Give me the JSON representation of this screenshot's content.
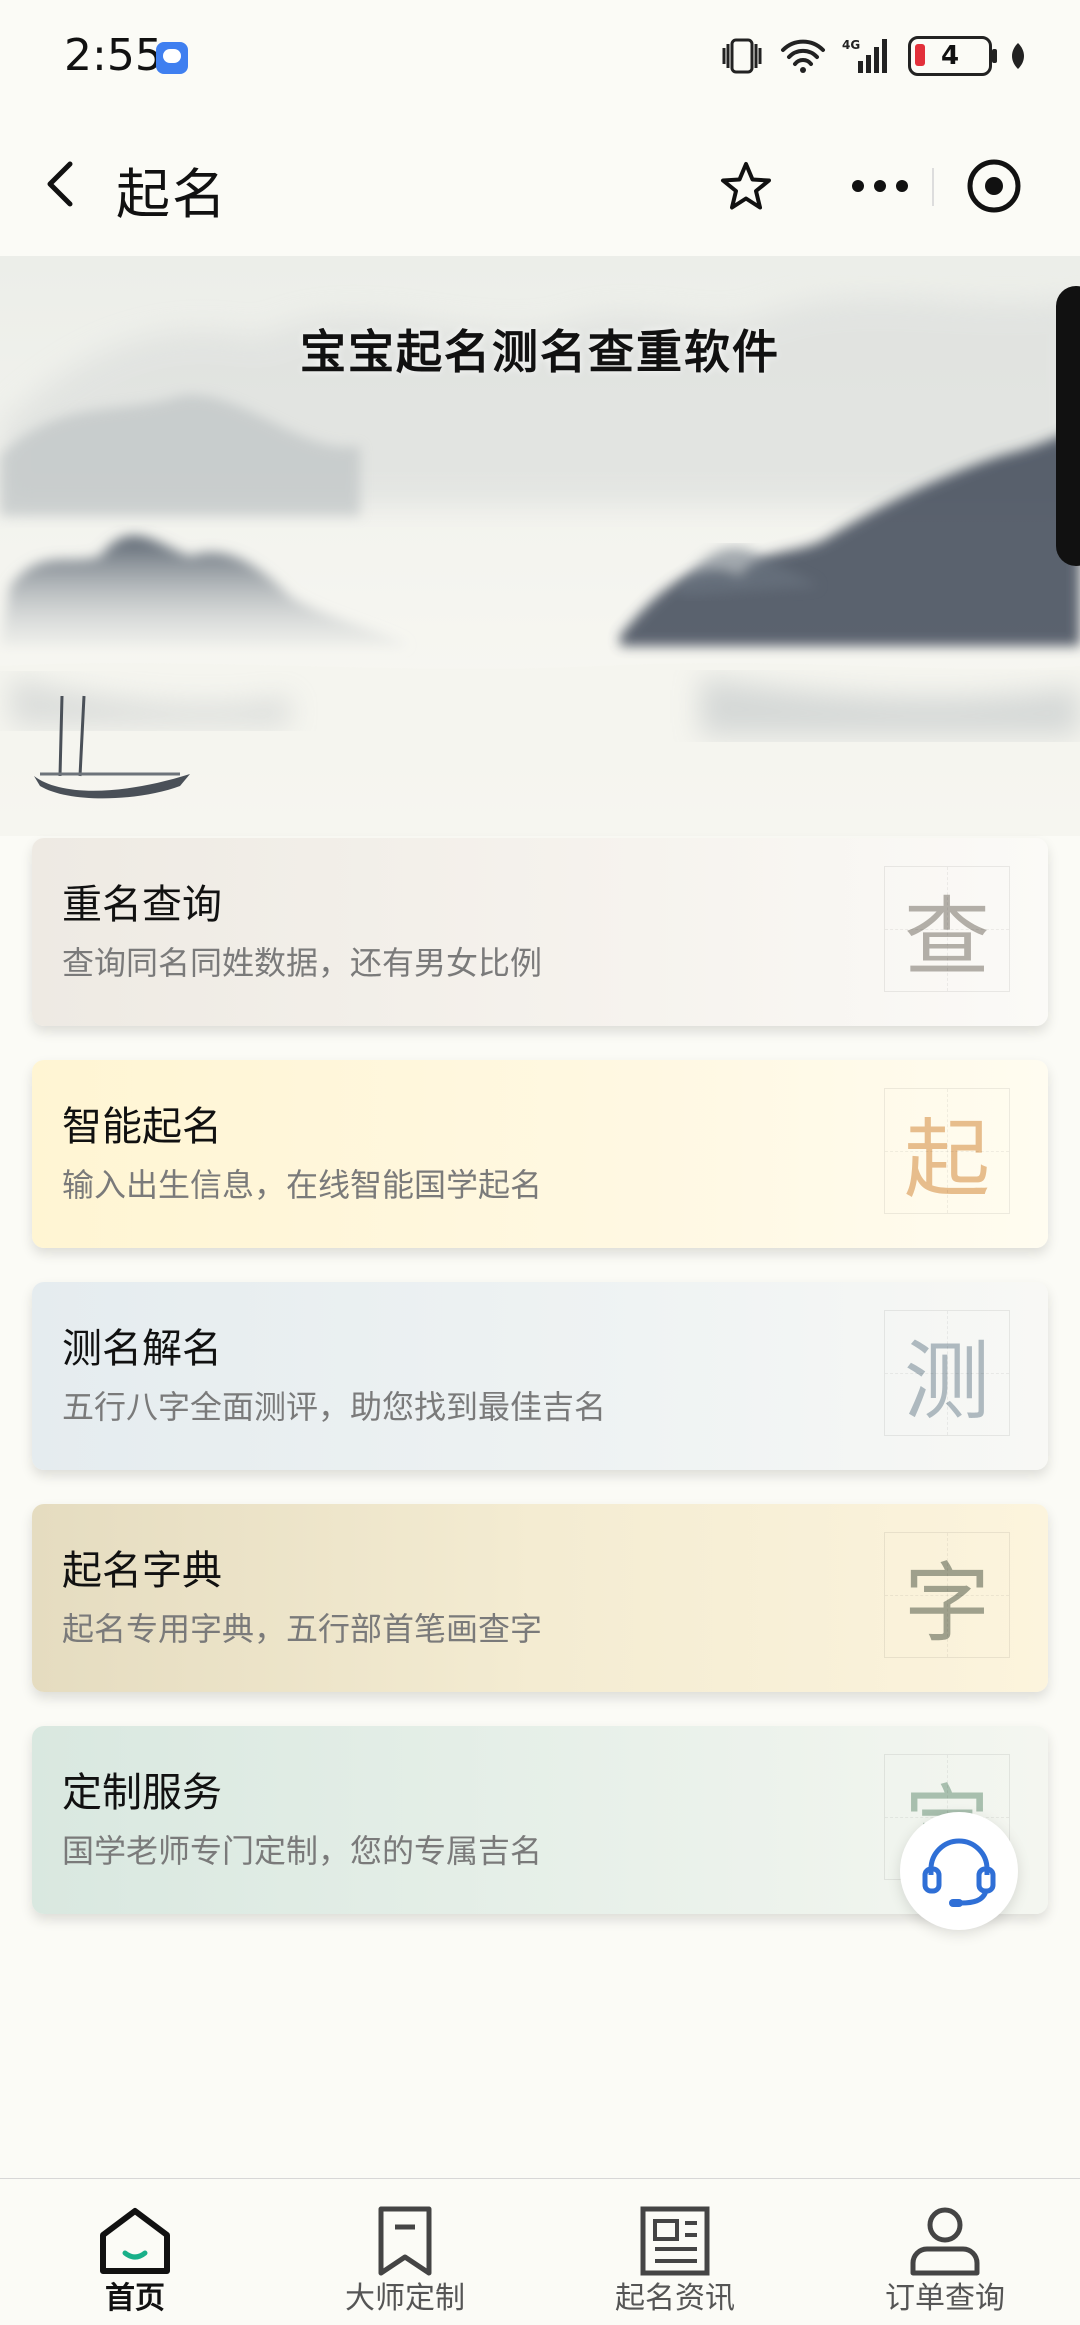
{
  "status_bar": {
    "time": "2:55",
    "battery": "4"
  },
  "nav": {
    "title": "起名"
  },
  "banner": {
    "title": "宝宝起名测名查重软件"
  },
  "cards": [
    {
      "title": "重名查询",
      "desc": "查询同名同姓数据，还有男女比例",
      "stamp": "查"
    },
    {
      "title": "智能起名",
      "desc": "输入出生信息，在线智能国学起名",
      "stamp": "起"
    },
    {
      "title": "测名解名",
      "desc": "五行八字全面测评，助您找到最佳吉名",
      "stamp": "测"
    },
    {
      "title": "起名字典",
      "desc": "起名专用字典，五行部首笔画查字",
      "stamp": "字"
    },
    {
      "title": "定制服务",
      "desc": "国学老师专门定制，您的专属吉名",
      "stamp": "定"
    }
  ],
  "tabbar": {
    "items": [
      {
        "label": "首页",
        "icon": "home-icon",
        "active": true
      },
      {
        "label": "大师定制",
        "icon": "bookmark-icon",
        "active": false
      },
      {
        "label": "起名资讯",
        "icon": "news-icon",
        "active": false
      },
      {
        "label": "订单查询",
        "icon": "user-icon",
        "active": false
      }
    ]
  },
  "colors": {
    "accent": "#2f6fd6",
    "home_smile": "#19b089"
  }
}
